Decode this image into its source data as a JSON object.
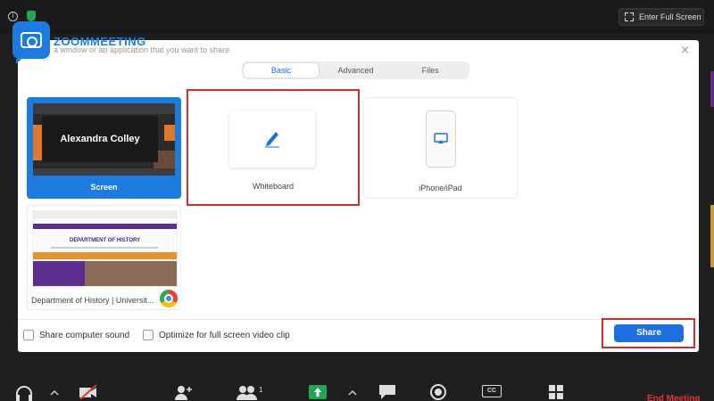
{
  "brand": {
    "logo_text": "ZOOMMEETING",
    "accent": "#1d7be0"
  },
  "topbar": {
    "fullscreen_label": "Enter Full Screen"
  },
  "dialog": {
    "title": "a window or an application that you want to share",
    "close_glyph": "×",
    "tabs": [
      {
        "label": "Basic",
        "active": true
      },
      {
        "label": "Advanced",
        "active": false
      },
      {
        "label": "Files",
        "active": false
      }
    ],
    "tiles": {
      "screen": {
        "label": "Screen",
        "preview_name": "Alexandra Colley",
        "selected": true
      },
      "whiteboard": {
        "label": "Whiteboard",
        "highlighted": true
      },
      "iphone": {
        "label": "iPhone/iPad"
      },
      "window": {
        "label": "Department of History | Universit...",
        "preview_heading": "DEPARTMENT OF HISTORY"
      }
    },
    "options": {
      "share_sound": {
        "label": "Share computer sound",
        "checked": false
      },
      "optimize_video": {
        "label": "Optimize for full screen video clip",
        "checked": false
      }
    },
    "share_button": "Share",
    "highlight_color": "#d62a2f"
  },
  "toolbar": {
    "participants_count": "1",
    "cc_label": "CC",
    "end_meeting": "End Meeting"
  }
}
